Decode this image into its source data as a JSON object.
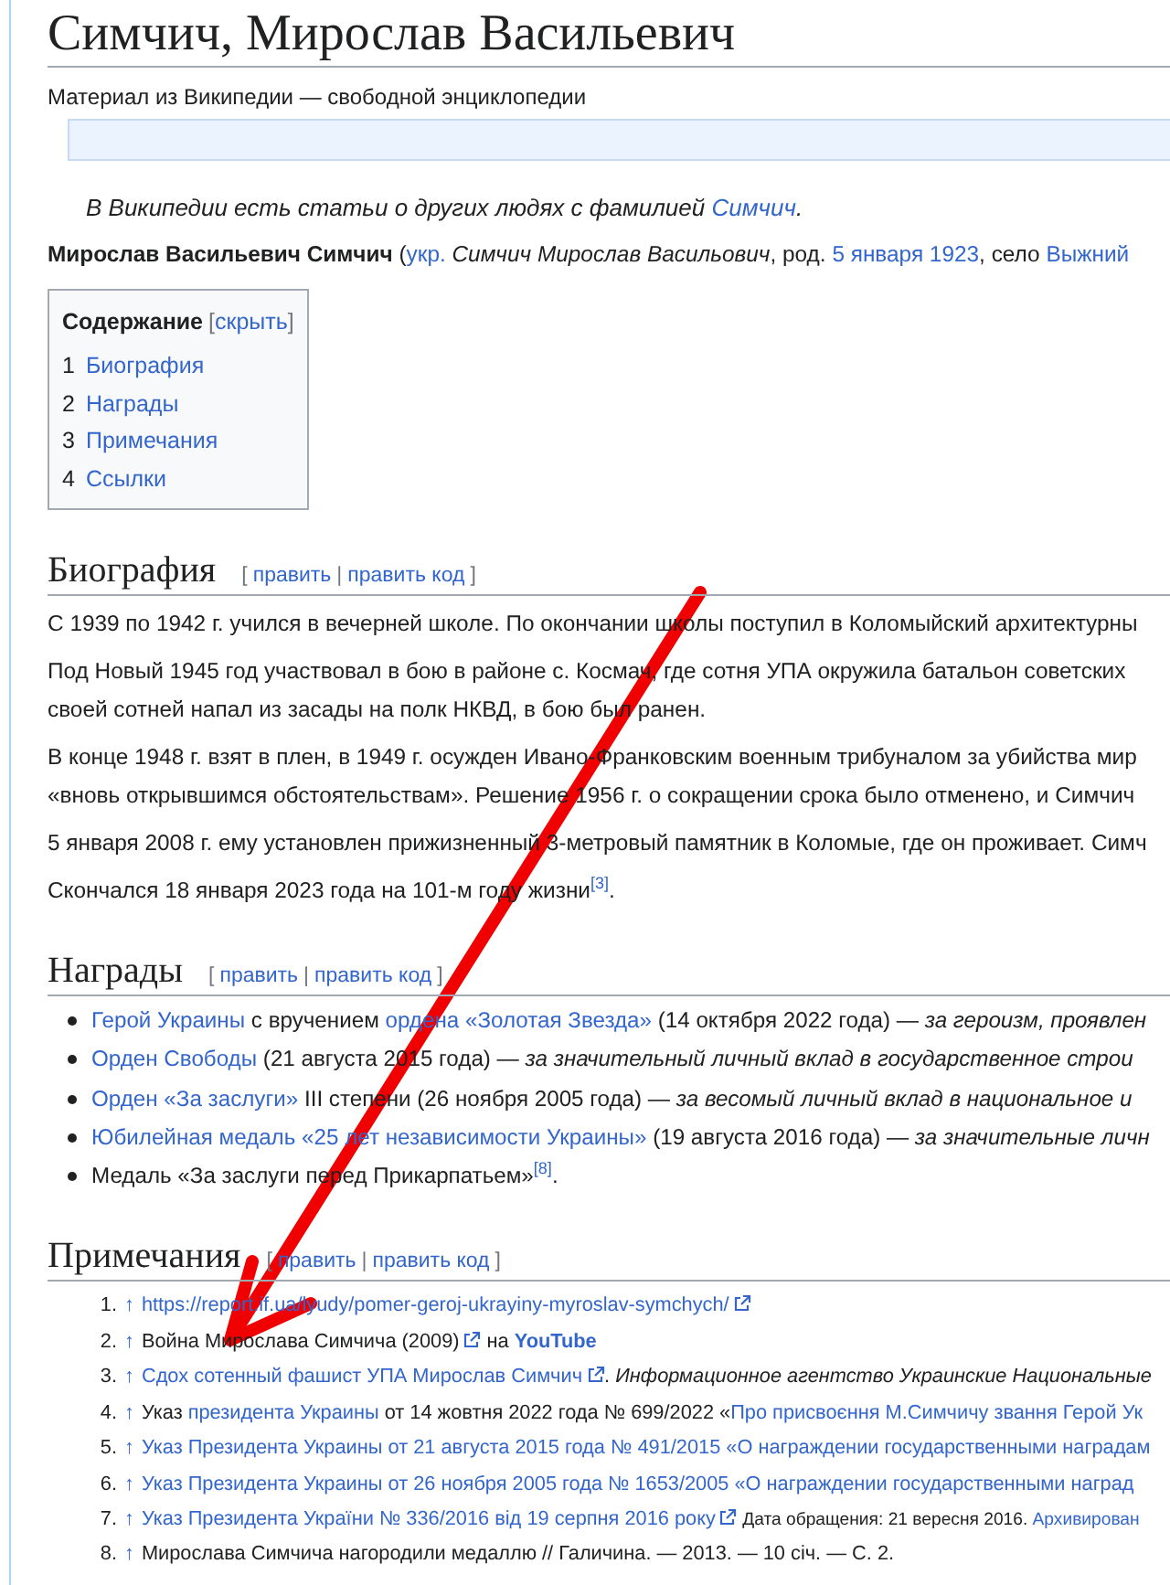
{
  "article": {
    "title": "Симчич, Мирослав Васильевич",
    "tagline": "Материал из Википедии — свободной энциклопедии",
    "hatnote": [
      {
        "kind": "italic",
        "text": "В Википедии есть статьи о других людях с фамилией "
      },
      {
        "kind": "link_italic",
        "text": "Симчич"
      },
      {
        "kind": "italic",
        "text": "."
      }
    ],
    "lead": [
      {
        "kind": "bold",
        "text": "Мирослав Васильевич Симчич"
      },
      {
        "kind": "plain",
        "text": " ("
      },
      {
        "kind": "link",
        "text": "укр."
      },
      {
        "kind": "italic",
        "text": " Симчич Мирослав Васильович"
      },
      {
        "kind": "plain",
        "text": ", род. "
      },
      {
        "kind": "link",
        "text": "5 января 1923"
      },
      {
        "kind": "plain",
        "text": ", село "
      },
      {
        "kind": "link",
        "text": "Выжний"
      }
    ]
  },
  "toc": {
    "title": "Содержание",
    "toggle_open": "[",
    "toggle": "скрыть",
    "toggle_close": "]",
    "items": [
      {
        "number": "1",
        "label": "Биография"
      },
      {
        "number": "2",
        "label": "Награды"
      },
      {
        "number": "3",
        "label": "Примечания"
      },
      {
        "number": "4",
        "label": "Ссылки"
      }
    ]
  },
  "sections": [
    {
      "heading": "Биография",
      "edit_open": "[",
      "edit": "править",
      "edit_sep": "|",
      "edit_code": "править код",
      "edit_close": "]",
      "kind": "paragraphs",
      "paragraphs": [
        {
          "lines": [
            [
              {
                "kind": "plain",
                "text": "С 1939 по 1942 г. учился в вечерней школе. По окончании школы поступил в Коломыйский архитектурны"
              }
            ]
          ]
        },
        {
          "lines": [
            [
              {
                "kind": "plain",
                "text": "Под Новый 1945 год участвовал в бою в районе с. Космач, где сотня УПА окружила батальон советских"
              }
            ],
            [
              {
                "kind": "plain",
                "text": "своей сотней напал из засады на полк НКВД, в бою был ранен."
              }
            ]
          ]
        },
        {
          "lines": [
            [
              {
                "kind": "plain",
                "text": "В конце 1948 г. взят в плен, в 1949 г. осужден Ивано-Франковским военным трибуналом за убийства мир"
              }
            ],
            [
              {
                "kind": "plain",
                "text": "«вновь открывшимся обстоятельствам». Решение 1956 г. о сокращении срока было отменено, и Симчич"
              }
            ]
          ]
        },
        {
          "lines": [
            [
              {
                "kind": "plain",
                "text": "5 января 2008 г. ему установлен прижизненный 3-метровый памятник в Коломые, где он проживает. Симч"
              }
            ]
          ]
        },
        {
          "lines": [
            [
              {
                "kind": "plain",
                "text": "Скончался 18 января 2023 года на 101-м году жизни"
              },
              {
                "kind": "ref",
                "text": "[3]"
              },
              {
                "kind": "plain",
                "text": "."
              }
            ]
          ]
        }
      ]
    },
    {
      "heading": "Награды",
      "edit_open": "[",
      "edit": "править",
      "edit_sep": "|",
      "edit_code": "править код",
      "edit_close": "]",
      "kind": "bullets",
      "items": [
        [
          {
            "kind": "link",
            "text": "Герой Украины"
          },
          {
            "kind": "plain",
            "text": " с вручением "
          },
          {
            "kind": "link",
            "text": "ордена «Золотая Звезда»"
          },
          {
            "kind": "plain",
            "text": " (14 октября 2022 года) — "
          },
          {
            "kind": "italic",
            "text": "за героизм, проявлен"
          }
        ],
        [
          {
            "kind": "link",
            "text": "Орден Свободы"
          },
          {
            "kind": "plain",
            "text": " (21 августа 2015 года) — "
          },
          {
            "kind": "italic",
            "text": "за значительный личный вклад в государственное строи"
          }
        ],
        [
          {
            "kind": "link",
            "text": "Орден «За заслуги»"
          },
          {
            "kind": "plain",
            "text": " III степени (26 ноября 2005 года) — "
          },
          {
            "kind": "italic",
            "text": "за весомый личный вклад в национальное и"
          }
        ],
        [
          {
            "kind": "link",
            "text": "Юбилейная медаль «25 лет независимости Украины»"
          },
          {
            "kind": "plain",
            "text": " (19 августа 2016 года) — "
          },
          {
            "kind": "italic",
            "text": "за значительные личн"
          }
        ],
        [
          {
            "kind": "plain",
            "text": "Медаль «За заслуги перед Прикарпатьем»"
          },
          {
            "kind": "ref",
            "text": "[8]"
          },
          {
            "kind": "plain",
            "text": "."
          }
        ]
      ]
    },
    {
      "heading": "Примечания",
      "edit_open": "[",
      "edit": "править",
      "edit_sep": "|",
      "edit_code": "править код",
      "edit_close": "]",
      "kind": "notes",
      "notes": [
        {
          "number": "1.",
          "backlink": "↑",
          "parts": [
            {
              "kind": "link",
              "text": "https://report.if.ua/lyudy/pomer-geroj-ukrayiny-myroslav-symchych/",
              "external": true
            }
          ]
        },
        {
          "number": "2.",
          "backlink": "↑",
          "parts": [
            {
              "kind": "plain",
              "text": "Война Мирослава Симчича (2009)",
              "external": true
            },
            {
              "kind": "plain",
              "text": " на "
            },
            {
              "kind": "link_bold",
              "text": "YouTube"
            }
          ]
        },
        {
          "number": "3.",
          "backlink": "↑",
          "parts": [
            {
              "kind": "link",
              "text": "Сдох сотенный фашист УПА Мирослав Симчич",
              "external": true
            },
            {
              "kind": "plain",
              "text": ". "
            },
            {
              "kind": "italic",
              "text": "Информационное агентство Украинские Национальные"
            }
          ]
        },
        {
          "number": "4.",
          "backlink": "↑",
          "parts": [
            {
              "kind": "plain",
              "text": "Указ "
            },
            {
              "kind": "link",
              "text": "президента Украины"
            },
            {
              "kind": "plain",
              "text": " от 14 жовтня 2022 года № 699/2022 «"
            },
            {
              "kind": "link",
              "text": "Про присвоєння М.Симчичу звання Герой Ук"
            }
          ]
        },
        {
          "number": "5.",
          "backlink": "↑",
          "parts": [
            {
              "kind": "link",
              "text": "Указ Президента Украины от 21 августа 2015 года № 491/2015 «О награждении государственными наградам"
            }
          ]
        },
        {
          "number": "6.",
          "backlink": "↑",
          "parts": [
            {
              "kind": "link",
              "text": "Указ Президента Украины от 26 ноября 2005 года № 1653/2005 «О награждении государственными наград"
            }
          ]
        },
        {
          "number": "7.",
          "backlink": "↑",
          "parts": [
            {
              "kind": "link",
              "text": "Указ Президента України № 336/2016 від 19 серпня 2016 року",
              "external": true
            },
            {
              "kind": "small",
              "text": " Дата обращения: 21 вересня 2016. "
            },
            {
              "kind": "link_small",
              "text": "Архивирован"
            }
          ]
        },
        {
          "number": "8.",
          "backlink": "↑",
          "parts": [
            {
              "kind": "plain",
              "text": "Мирослава Симчича нагородили медаллю // Галичина. — 2013. — 10 січ. — С. 2."
            }
          ]
        }
      ]
    }
  ]
}
